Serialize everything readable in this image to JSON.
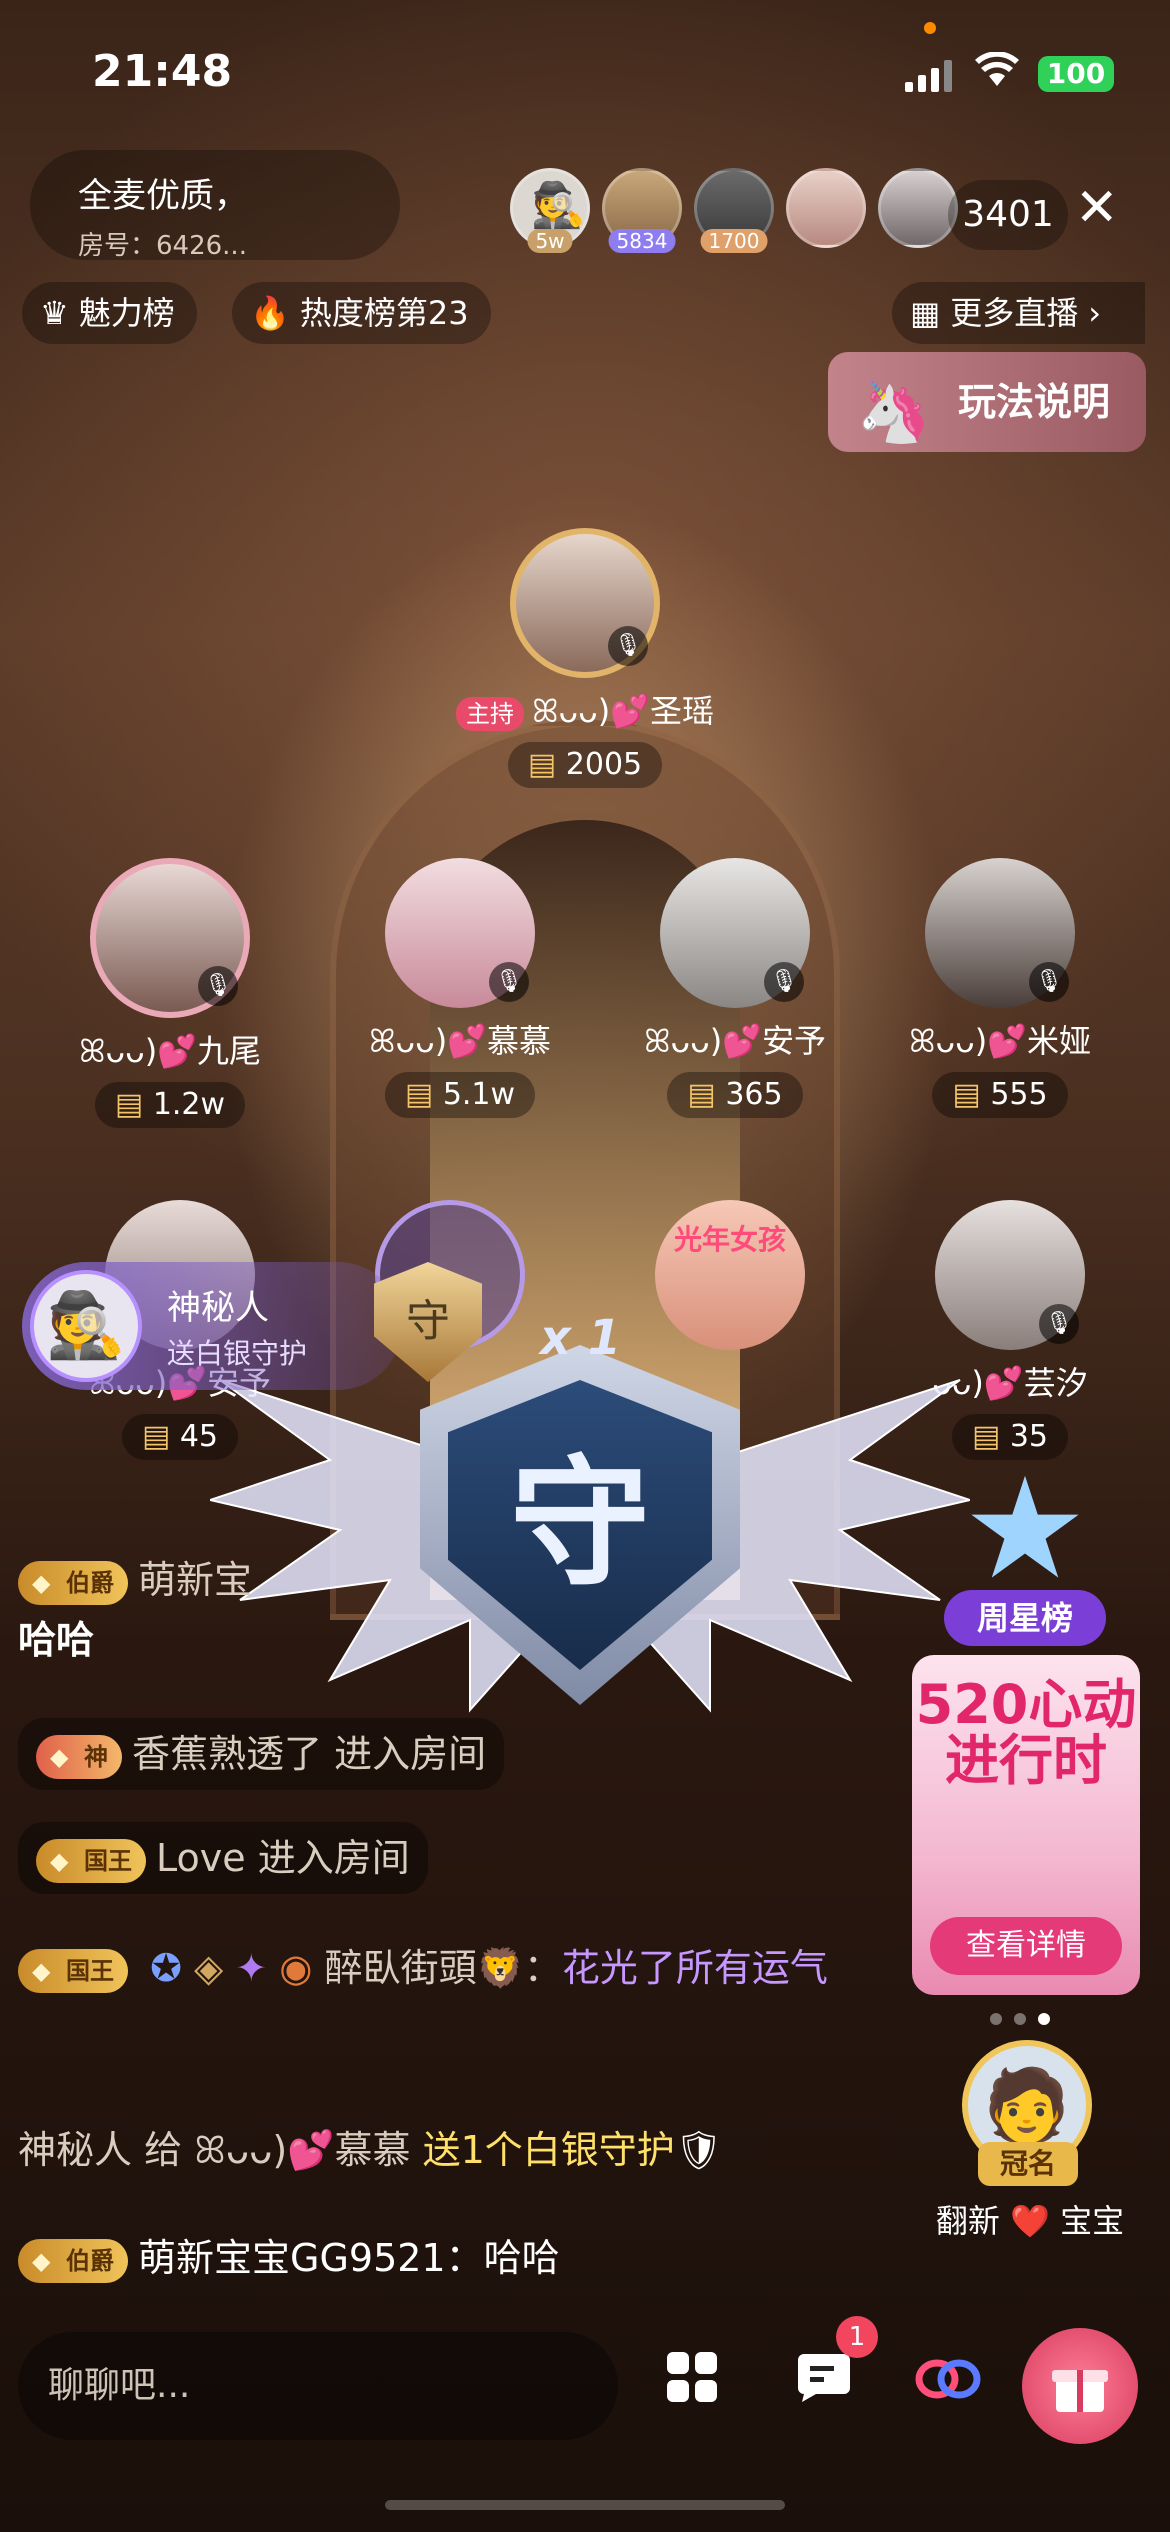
{
  "status": {
    "time": "21:48",
    "battery": "100"
  },
  "room": {
    "title": "全麦优质，",
    "number": "房号：6426..."
  },
  "viewers": {
    "badges": [
      "5w",
      "5834",
      "1700"
    ],
    "count": "3401"
  },
  "tabs": {
    "charm": "魅力榜",
    "heat": "热度榜第23",
    "more": "更多直播",
    "rules": "玩法说明"
  },
  "host": {
    "tag": "主持",
    "name": "ꕤᴗᴗ)💕圣瑶",
    "value": "2005"
  },
  "seats_row1": [
    {
      "name": "ꕤᴗᴗ)💕九尾",
      "value": "1.2w"
    },
    {
      "name": "ꕤᴗᴗ)💕慕慕",
      "value": "5.1w"
    },
    {
      "name": "ꕤᴗᴗ)💕安予",
      "value": "365"
    },
    {
      "name": "ꕤᴗᴗ)💕米娅",
      "value": "555"
    }
  ],
  "seats_row2": [
    {
      "name": "ꕤᴗᴗ)💕安予",
      "value": "45"
    },
    {
      "name": "ᴗᴗ)💕芸汐",
      "value": "35"
    }
  ],
  "seat_banner": "光年女孩",
  "guard": {
    "name": "神秘人",
    "desc": "送白银守护",
    "char": "守",
    "count": "x 1"
  },
  "chat": {
    "m1_level": "伯爵",
    "m1_user": "萌新宝",
    "m1_text": "哈哈",
    "m2_level": "神",
    "m2_user": "香蕉熟透了",
    "m2_action": "进入房间",
    "m3_level": "国王",
    "m3_user": "Love",
    "m3_action": "进入房间",
    "m4_level": "国王",
    "m4_user": "醉臥街頭",
    "m4_colon": "：",
    "m4_text": "花光了所有运气",
    "m5_user": "神秘人",
    "m5_give": "给",
    "m5_target": "ꕤᴗᴗ)💕慕慕",
    "m5_gift": "送1个白银守护",
    "m6_level": "伯爵",
    "m6_user": "萌新宝宝GG9521：",
    "m6_text": "哈哈"
  },
  "side": {
    "weekly": "周星榜",
    "promo_title": "520心动进行时",
    "promo_btn": "查看详情",
    "crown_tag": "冠名",
    "crown_name": "翻新 ❤️ 宝宝"
  },
  "bottom": {
    "placeholder": "聊聊吧...",
    "notif": "1"
  },
  "colors": {
    "gold": "#f4c469",
    "purple": "#c697ff",
    "gift": "#e53a78",
    "weekly": "#7b3fd8"
  }
}
